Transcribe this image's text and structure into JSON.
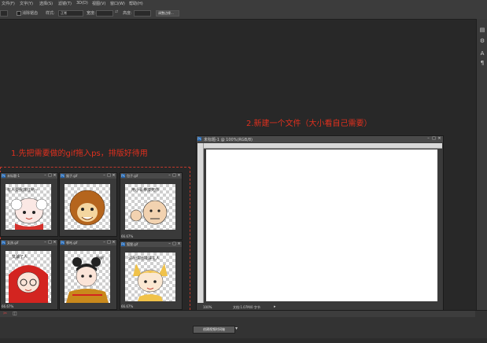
{
  "menubar": {
    "items": [
      "文件(F)",
      "文字(Y)",
      "选择(S)",
      "滤镜(T)",
      "3D(D)",
      "视图(V)",
      "窗口(W)",
      "帮助(H)"
    ]
  },
  "options_bar": {
    "antialias_label": "消除锯齿",
    "style_label": "样式:",
    "style_value": "正常",
    "width_label": "宽度:",
    "height_label": "高度:",
    "refine_edge_button": "调整边缘..."
  },
  "annotations": {
    "step1": "1.先把需要做的gif拖入ps，排版好待用",
    "step2": "2.新建一个文件（大小看自己需要）"
  },
  "gif_windows": [
    {
      "name": "未标题-1",
      "zoom": "",
      "caption": "有人要我抹往哟~"
    },
    {
      "name": "猴子.gif",
      "zoom": "",
      "caption": ""
    },
    {
      "name": "包子.gif",
      "zoom": "66.67%",
      "caption": "用小青拳揍死你"
    },
    {
      "name": "女孩.gif",
      "zoom": "66.67%",
      "caption": "又骗了人"
    },
    {
      "name": "哪吒.gif",
      "zoom": "",
      "caption": "我咧"
    },
    {
      "name": "狐狸.gif",
      "zoom": "66.67%",
      "caption": "请尽情地揉搓主人"
    }
  ],
  "new_document": {
    "title": "未标题-1 @ 100%(RGB/8)",
    "zoom": "100%",
    "doc_info": "文档:1.07M/0 字节"
  },
  "timeline": {
    "create_button": "创建视频时间轴"
  },
  "colors": {
    "annotation": "#e0301e",
    "workspace": "#282828",
    "panel": "#3c3c3c"
  }
}
